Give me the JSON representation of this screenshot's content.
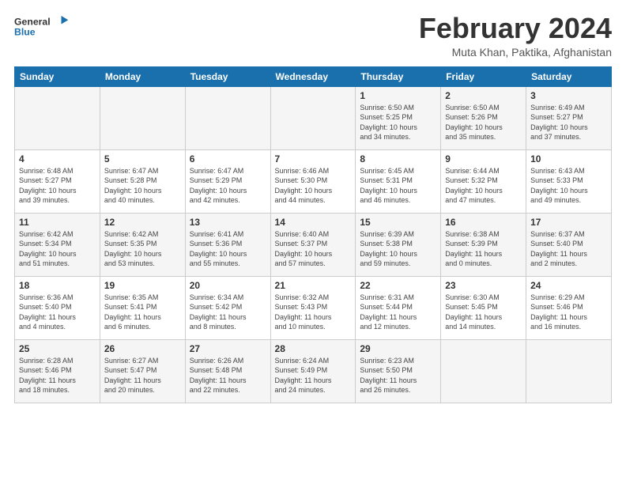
{
  "logo": {
    "line1": "General",
    "line2": "Blue"
  },
  "title": "February 2024",
  "subtitle": "Muta Khan, Paktika, Afghanistan",
  "days_header": [
    "Sunday",
    "Monday",
    "Tuesday",
    "Wednesday",
    "Thursday",
    "Friday",
    "Saturday"
  ],
  "weeks": [
    [
      {
        "day": "",
        "info": ""
      },
      {
        "day": "",
        "info": ""
      },
      {
        "day": "",
        "info": ""
      },
      {
        "day": "",
        "info": ""
      },
      {
        "day": "1",
        "info": "Sunrise: 6:50 AM\nSunset: 5:25 PM\nDaylight: 10 hours\nand 34 minutes."
      },
      {
        "day": "2",
        "info": "Sunrise: 6:50 AM\nSunset: 5:26 PM\nDaylight: 10 hours\nand 35 minutes."
      },
      {
        "day": "3",
        "info": "Sunrise: 6:49 AM\nSunset: 5:27 PM\nDaylight: 10 hours\nand 37 minutes."
      }
    ],
    [
      {
        "day": "4",
        "info": "Sunrise: 6:48 AM\nSunset: 5:27 PM\nDaylight: 10 hours\nand 39 minutes."
      },
      {
        "day": "5",
        "info": "Sunrise: 6:47 AM\nSunset: 5:28 PM\nDaylight: 10 hours\nand 40 minutes."
      },
      {
        "day": "6",
        "info": "Sunrise: 6:47 AM\nSunset: 5:29 PM\nDaylight: 10 hours\nand 42 minutes."
      },
      {
        "day": "7",
        "info": "Sunrise: 6:46 AM\nSunset: 5:30 PM\nDaylight: 10 hours\nand 44 minutes."
      },
      {
        "day": "8",
        "info": "Sunrise: 6:45 AM\nSunset: 5:31 PM\nDaylight: 10 hours\nand 46 minutes."
      },
      {
        "day": "9",
        "info": "Sunrise: 6:44 AM\nSunset: 5:32 PM\nDaylight: 10 hours\nand 47 minutes."
      },
      {
        "day": "10",
        "info": "Sunrise: 6:43 AM\nSunset: 5:33 PM\nDaylight: 10 hours\nand 49 minutes."
      }
    ],
    [
      {
        "day": "11",
        "info": "Sunrise: 6:42 AM\nSunset: 5:34 PM\nDaylight: 10 hours\nand 51 minutes."
      },
      {
        "day": "12",
        "info": "Sunrise: 6:42 AM\nSunset: 5:35 PM\nDaylight: 10 hours\nand 53 minutes."
      },
      {
        "day": "13",
        "info": "Sunrise: 6:41 AM\nSunset: 5:36 PM\nDaylight: 10 hours\nand 55 minutes."
      },
      {
        "day": "14",
        "info": "Sunrise: 6:40 AM\nSunset: 5:37 PM\nDaylight: 10 hours\nand 57 minutes."
      },
      {
        "day": "15",
        "info": "Sunrise: 6:39 AM\nSunset: 5:38 PM\nDaylight: 10 hours\nand 59 minutes."
      },
      {
        "day": "16",
        "info": "Sunrise: 6:38 AM\nSunset: 5:39 PM\nDaylight: 11 hours\nand 0 minutes."
      },
      {
        "day": "17",
        "info": "Sunrise: 6:37 AM\nSunset: 5:40 PM\nDaylight: 11 hours\nand 2 minutes."
      }
    ],
    [
      {
        "day": "18",
        "info": "Sunrise: 6:36 AM\nSunset: 5:40 PM\nDaylight: 11 hours\nand 4 minutes."
      },
      {
        "day": "19",
        "info": "Sunrise: 6:35 AM\nSunset: 5:41 PM\nDaylight: 11 hours\nand 6 minutes."
      },
      {
        "day": "20",
        "info": "Sunrise: 6:34 AM\nSunset: 5:42 PM\nDaylight: 11 hours\nand 8 minutes."
      },
      {
        "day": "21",
        "info": "Sunrise: 6:32 AM\nSunset: 5:43 PM\nDaylight: 11 hours\nand 10 minutes."
      },
      {
        "day": "22",
        "info": "Sunrise: 6:31 AM\nSunset: 5:44 PM\nDaylight: 11 hours\nand 12 minutes."
      },
      {
        "day": "23",
        "info": "Sunrise: 6:30 AM\nSunset: 5:45 PM\nDaylight: 11 hours\nand 14 minutes."
      },
      {
        "day": "24",
        "info": "Sunrise: 6:29 AM\nSunset: 5:46 PM\nDaylight: 11 hours\nand 16 minutes."
      }
    ],
    [
      {
        "day": "25",
        "info": "Sunrise: 6:28 AM\nSunset: 5:46 PM\nDaylight: 11 hours\nand 18 minutes."
      },
      {
        "day": "26",
        "info": "Sunrise: 6:27 AM\nSunset: 5:47 PM\nDaylight: 11 hours\nand 20 minutes."
      },
      {
        "day": "27",
        "info": "Sunrise: 6:26 AM\nSunset: 5:48 PM\nDaylight: 11 hours\nand 22 minutes."
      },
      {
        "day": "28",
        "info": "Sunrise: 6:24 AM\nSunset: 5:49 PM\nDaylight: 11 hours\nand 24 minutes."
      },
      {
        "day": "29",
        "info": "Sunrise: 6:23 AM\nSunset: 5:50 PM\nDaylight: 11 hours\nand 26 minutes."
      },
      {
        "day": "",
        "info": ""
      },
      {
        "day": "",
        "info": ""
      }
    ]
  ]
}
